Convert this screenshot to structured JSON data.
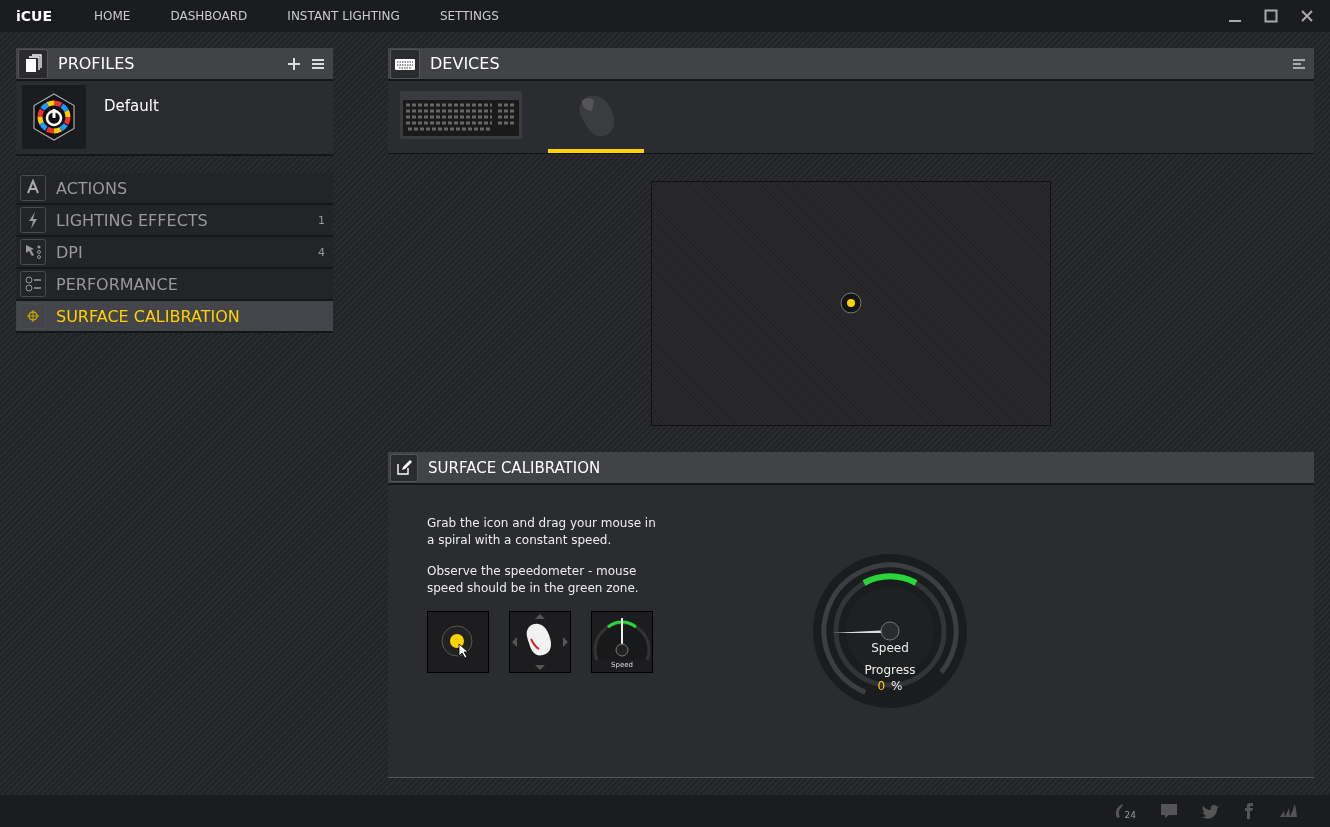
{
  "app": {
    "logo": "iCUE"
  },
  "nav": [
    {
      "label": "HOME",
      "selected": false
    },
    {
      "label": "DASHBOARD",
      "selected": false
    },
    {
      "label": "INSTANT LIGHTING",
      "selected": false
    },
    {
      "label": "SETTINGS",
      "selected": false
    }
  ],
  "profiles": {
    "title": "PROFILES",
    "items": [
      {
        "name": "Default"
      }
    ]
  },
  "menu": [
    {
      "kind": "actions",
      "label": "ACTIONS",
      "selected": false
    },
    {
      "kind": "lighting",
      "label": "LIGHTING EFFECTS",
      "count": "1",
      "selected": false
    },
    {
      "kind": "dpi",
      "label": "DPI",
      "count": "4",
      "selected": false
    },
    {
      "kind": "performance",
      "label": "PERFORMANCE",
      "selected": false
    },
    {
      "kind": "calibration",
      "label": "SURFACE CALIBRATION",
      "selected": true
    }
  ],
  "devices": {
    "title": "DEVICES",
    "tabs": [
      {
        "kind": "keyboard",
        "selected": false
      },
      {
        "kind": "mouse",
        "selected": true
      }
    ]
  },
  "calibration": {
    "title": "SURFACE CALIBRATION",
    "instructions": [
      "Grab the icon and drag your mouse in a spiral with a constant speed.",
      "Observe the speedometer - mouse speed should be in the green zone."
    ],
    "step_speed_label": "Speed",
    "gauge": {
      "speed_label": "Speed",
      "progress_label": "Progress",
      "progress_value": "0",
      "progress_unit": "%"
    }
  },
  "footer": {
    "support_badge": "24"
  }
}
